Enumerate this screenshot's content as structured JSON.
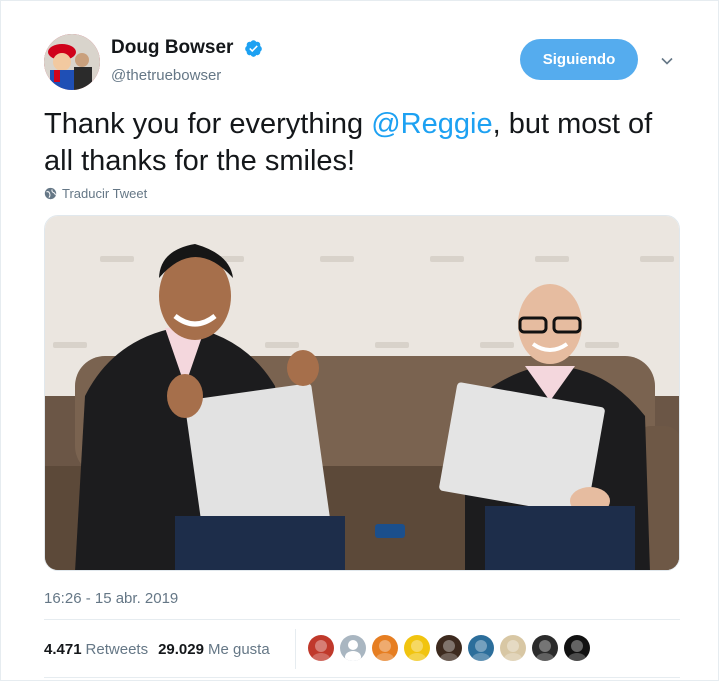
{
  "author": {
    "name": "Doug Bowser",
    "handle": "@thetruebowser",
    "verified": true
  },
  "follow_button": {
    "label": "Siguiendo"
  },
  "tweet": {
    "text_before": "Thank you for everything ",
    "mention": "@Reggie",
    "text_after": ", but most of all thanks for the smiles!",
    "translate_label": "Traducir Tweet"
  },
  "meta": {
    "timestamp": "16:26 - 15 abr. 2019",
    "retweets_count": "4.471",
    "retweets_label": "Retweets",
    "likes_count": "29.029",
    "likes_label": "Me gusta"
  },
  "likers": [
    {
      "icon": "liker-avatar-1",
      "color": "#c0392b"
    },
    {
      "icon": "liker-avatar-default",
      "color": "#a9b6c1"
    },
    {
      "icon": "liker-avatar-3",
      "color": "#e67e22"
    },
    {
      "icon": "liker-avatar-4",
      "color": "#f1c40f"
    },
    {
      "icon": "liker-avatar-5",
      "color": "#3d2a1e"
    },
    {
      "icon": "liker-avatar-6",
      "color": "#2c6e9b"
    },
    {
      "icon": "liker-avatar-7",
      "color": "#d8c7a4"
    },
    {
      "icon": "liker-avatar-8",
      "color": "#2b2b2b"
    },
    {
      "icon": "liker-avatar-9",
      "color": "#111111"
    }
  ],
  "colors": {
    "accent": "#1da1f2",
    "follow_bg": "#55acee",
    "muted": "#657786"
  }
}
